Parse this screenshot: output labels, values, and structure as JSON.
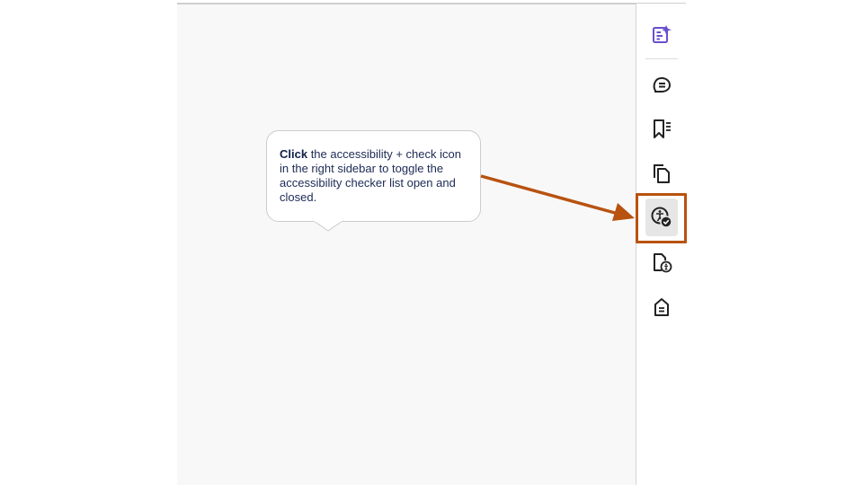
{
  "callout": {
    "bold": "Click",
    "text": " the accessibility + check icon in the right sidebar to toggle the accessibility checker list open and closed."
  },
  "sidebar": {
    "items": [
      {
        "icon": "edit-form-icon",
        "active": false
      },
      {
        "icon": "comment-icon",
        "active": false
      },
      {
        "icon": "bookmarks-icon",
        "active": false
      },
      {
        "icon": "pages-icon",
        "active": false
      },
      {
        "icon": "accessibility-check-icon",
        "active": true
      },
      {
        "icon": "accessibility-tags-icon",
        "active": false
      },
      {
        "icon": "document-tag-icon",
        "active": false
      }
    ]
  },
  "colors": {
    "accent": "#6a4fcf",
    "highlight": "#b8520f",
    "callout_text": "#1c2a55"
  }
}
